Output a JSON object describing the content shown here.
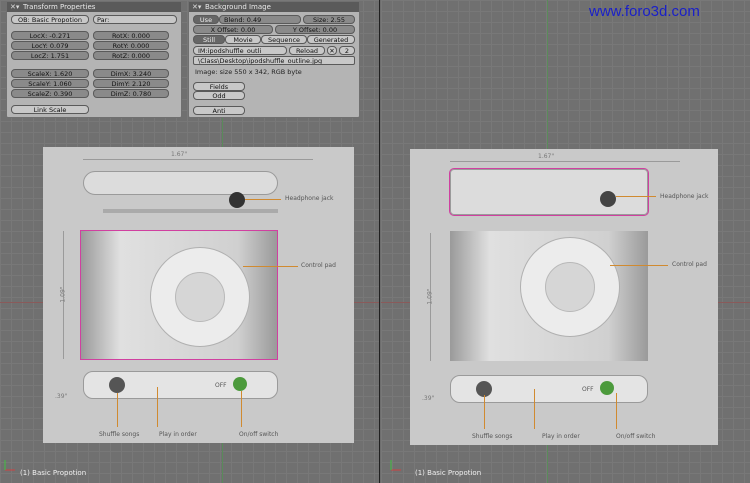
{
  "watermark": "www.foro3d.com",
  "transform_panel": {
    "title": "Transform Properties",
    "ob_field": "OB: Basic Propotion",
    "par_field": "Par:",
    "loc": [
      "LocX: -0.271",
      "LocY: 0.079",
      "LocZ: 1.751"
    ],
    "rot": [
      "RotX: 0.000",
      "RotY: 0.000",
      "RotZ: 0.000"
    ],
    "scale": [
      "ScaleX: 1.620",
      "ScaleY: 1.060",
      "ScaleZ: 0.390"
    ],
    "dim": [
      "DimX: 3.240",
      "DimY: 2.120",
      "DimZ: 0.780"
    ],
    "link_scale": "Link Scale"
  },
  "background_panel": {
    "title": "Background Image",
    "use": "Use",
    "blend": "Blend: 0.49",
    "size": "Size: 2.55",
    "x_offset": "X Offset: 0.00",
    "y_offset": "Y Offset: 0.00",
    "tabs": [
      "Still",
      "Movie",
      "Sequence",
      "Generated"
    ],
    "image_name": "IM:ipodshuffle_outli",
    "reload": "Reload",
    "users": "2",
    "path": "\\Class\\Desktop\\ipodshuffle_outline.jpg",
    "info": "Image: size 550 x 342, RGB byte",
    "fields": "Fields",
    "odd": "Odd",
    "anti": "Anti"
  },
  "viewport_left": {
    "footer": "(1) Basic Propotion"
  },
  "viewport_right": {
    "footer": "(1) Basic Propotion"
  },
  "ref_image": {
    "dim_top": "1.67\"",
    "dim_side": "1.09\"",
    "dim_bottom": ".39\"",
    "label_jack": "Headphone jack",
    "label_pad": "Control pad",
    "label_shuffle": "Shuffle songs",
    "label_play": "Play in order",
    "label_onoff": "On/off switch",
    "label_off": "OFF"
  }
}
